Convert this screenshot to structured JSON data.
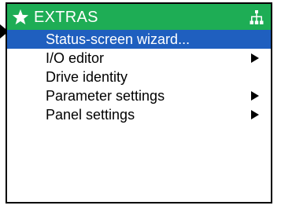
{
  "header": {
    "title": "EXTRAS",
    "star_icon": "star-icon",
    "network_icon": "network-tree-icon"
  },
  "menu": {
    "items": [
      {
        "label": "Status-screen wizard...",
        "selected": true,
        "has_submenu": false
      },
      {
        "label": "I/O editor",
        "selected": false,
        "has_submenu": true
      },
      {
        "label": "Drive identity",
        "selected": false,
        "has_submenu": false
      },
      {
        "label": "Parameter settings",
        "selected": false,
        "has_submenu": true
      },
      {
        "label": "Panel settings",
        "selected": false,
        "has_submenu": true
      }
    ]
  },
  "colors": {
    "header_bg": "#1ead55",
    "selection_bg": "#1f5fbf",
    "text": "#000000",
    "selected_text": "#ffffff"
  }
}
